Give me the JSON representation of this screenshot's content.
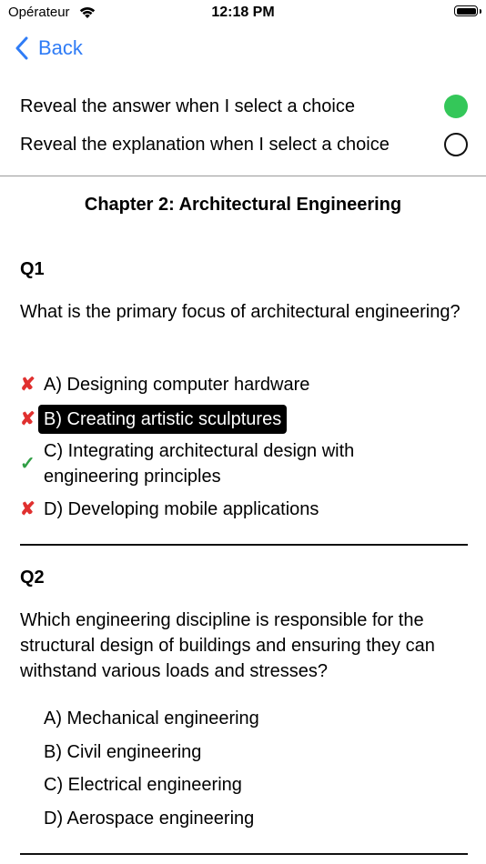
{
  "status_bar": {
    "carrier": "Opérateur",
    "time": "12:18 PM"
  },
  "nav": {
    "back_label": "Back"
  },
  "settings": {
    "reveal_answer": {
      "label": "Reveal the answer when I select a choice",
      "enabled": true
    },
    "reveal_explanation": {
      "label": "Reveal the explanation when I select a choice",
      "enabled": false
    }
  },
  "chapter_title": "Chapter 2: Architectural Engineering",
  "questions": [
    {
      "number": "Q1",
      "text": "What is the primary focus of architectural engineering?",
      "choices": [
        {
          "label": "A) Designing computer hardware",
          "mark": "✘",
          "status": "wrong"
        },
        {
          "label": "B) Creating artistic sculptures",
          "mark": "✘",
          "status": "wrong-selected"
        },
        {
          "label": "C) Integrating architectural design with engineering principles",
          "mark": "✓",
          "status": "correct"
        },
        {
          "label": "D) Developing mobile applications",
          "mark": "✘",
          "status": "wrong"
        }
      ]
    },
    {
      "number": "Q2",
      "text": "Which engineering discipline is responsible for the structural design of buildings and ensuring they can withstand various loads and stresses?",
      "choices": [
        {
          "label": "A) Mechanical engineering"
        },
        {
          "label": "B) Civil engineering"
        },
        {
          "label": "C) Electrical engineering"
        },
        {
          "label": "D) Aerospace engineering"
        }
      ]
    }
  ],
  "colors": {
    "accent": "#2f7cf6",
    "toggle_on": "#34c759",
    "wrong": "#e0302f",
    "correct": "#2f9e44"
  }
}
